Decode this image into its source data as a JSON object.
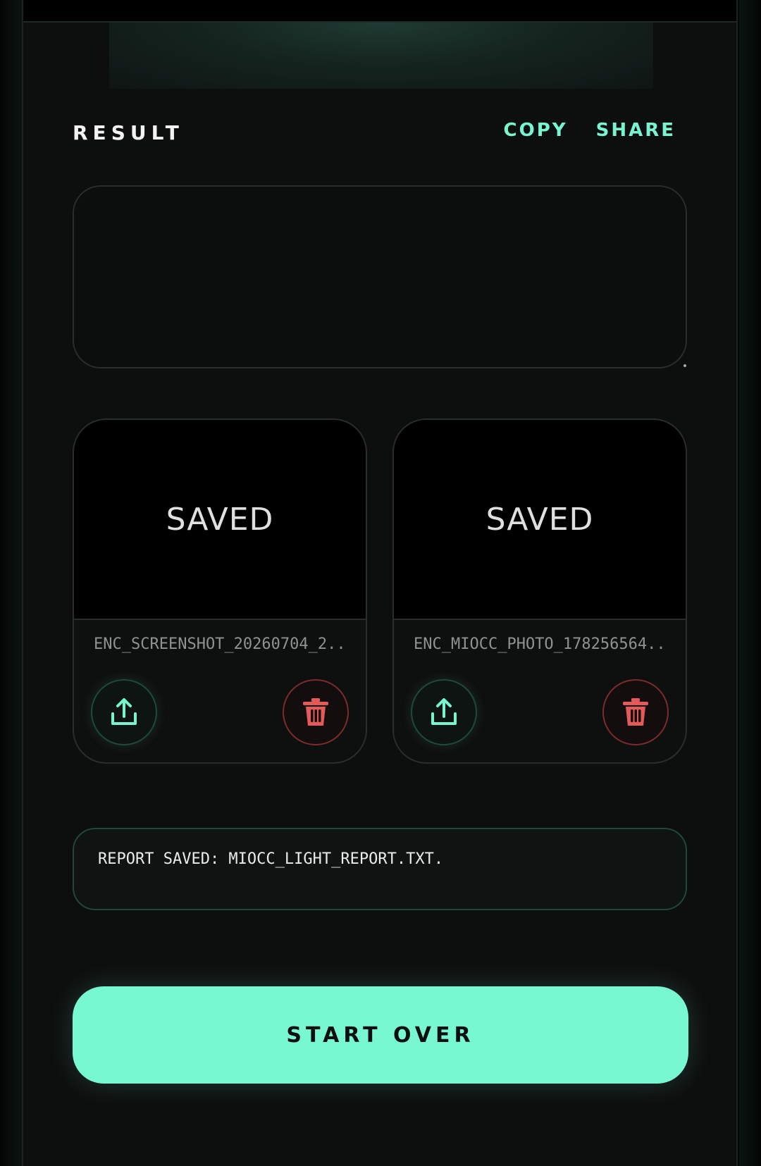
{
  "result": {
    "title": "RESULT",
    "copy_label": "COPY",
    "share_label": "SHARE",
    "text_value": ""
  },
  "files": [
    {
      "preview_label": "SAVED",
      "name": "ENC_SCREENSHOT_20260704_2..."
    },
    {
      "preview_label": "SAVED",
      "name": "ENC_MIOCC_PHOTO_178256564..."
    }
  ],
  "status": {
    "message": "REPORT SAVED: MIOCC_LIGHT_REPORT.TXT."
  },
  "actions": {
    "start_over_label": "START OVER"
  },
  "icons": {
    "share": "share-upload-icon",
    "delete": "trash-icon"
  },
  "colors": {
    "accent": "#78f8d0",
    "danger": "#e25a5a",
    "background": "#0d0e0e"
  }
}
